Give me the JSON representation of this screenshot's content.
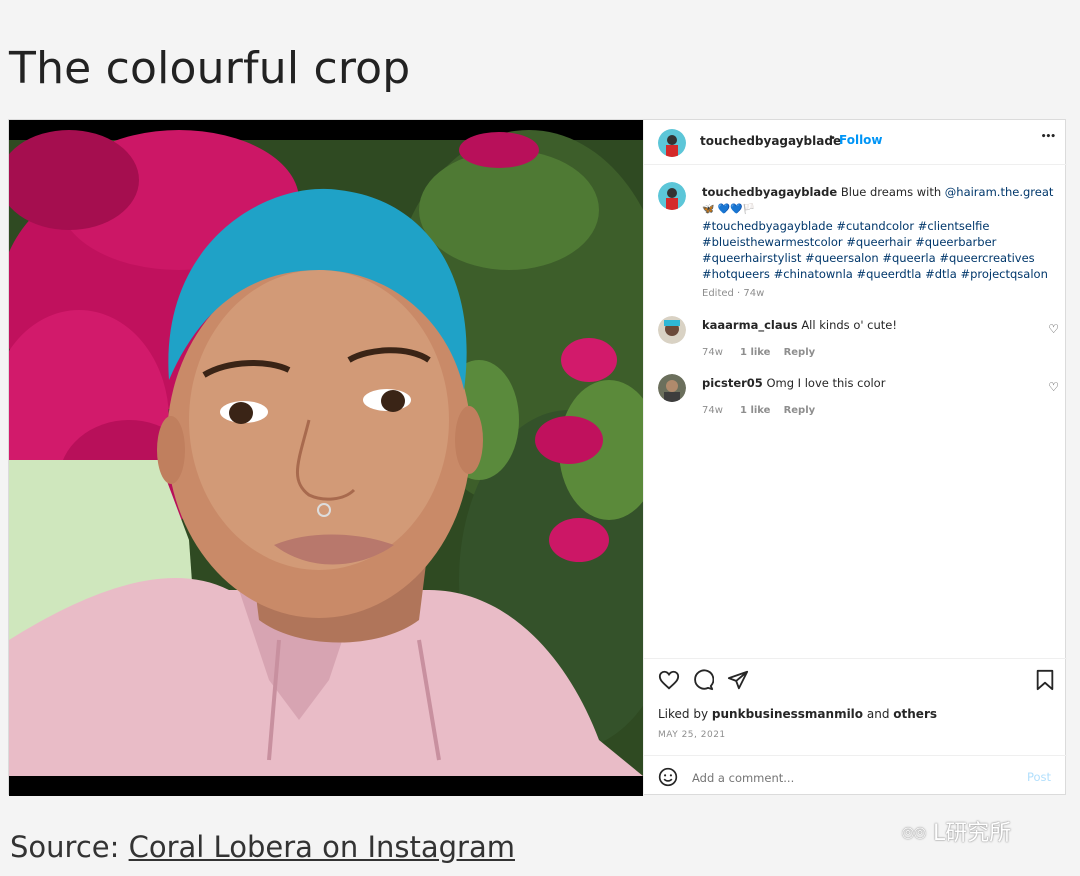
{
  "heading": "The colourful crop",
  "post": {
    "username": "touchedbyagayblade",
    "dot": "•",
    "follow": "Follow",
    "more": "•••",
    "caption": {
      "username": "touchedbyagayblade",
      "text_before": "Blue dreams with",
      "mention": "@hairam.the.great",
      "emoji_line": "🦋 💙💙🏳️",
      "tags": [
        "#touchedbyagayblade #cutandcolor #clientselfie",
        "#blueisthewarmestcolor #queerhair #queerbarber",
        "#queerhairstylist #queersalon #queerla #queercreatives",
        "#hotqueers #chinatownla #queerdtla #dtla #projectqsalon"
      ],
      "meta": "Edited · 74w"
    },
    "comments": [
      {
        "username": "kaaarma_claus",
        "text": "All kinds o' cute!",
        "age": "74w",
        "likes": "1 like",
        "reply": "Reply"
      },
      {
        "username": "picster05",
        "text": "Omg I love this color",
        "age": "74w",
        "likes": "1 like",
        "reply": "Reply"
      }
    ],
    "liked_by_prefix": "Liked by",
    "liked_by_user": "punkbusinessmanmilo",
    "liked_by_and": "and",
    "liked_by_others": "others",
    "date": "MAY 25, 2021",
    "add_comment_placeholder": "Add a comment...",
    "post_button": "Post"
  },
  "source_prefix": "Source: ",
  "source_link": "Coral Lobera on Instagram",
  "watermark": "L研究所",
  "colors": {
    "link": "#00376b",
    "follow": "#0095f6",
    "post_disabled": "#b2dffc",
    "muted": "#8e8e8e"
  }
}
